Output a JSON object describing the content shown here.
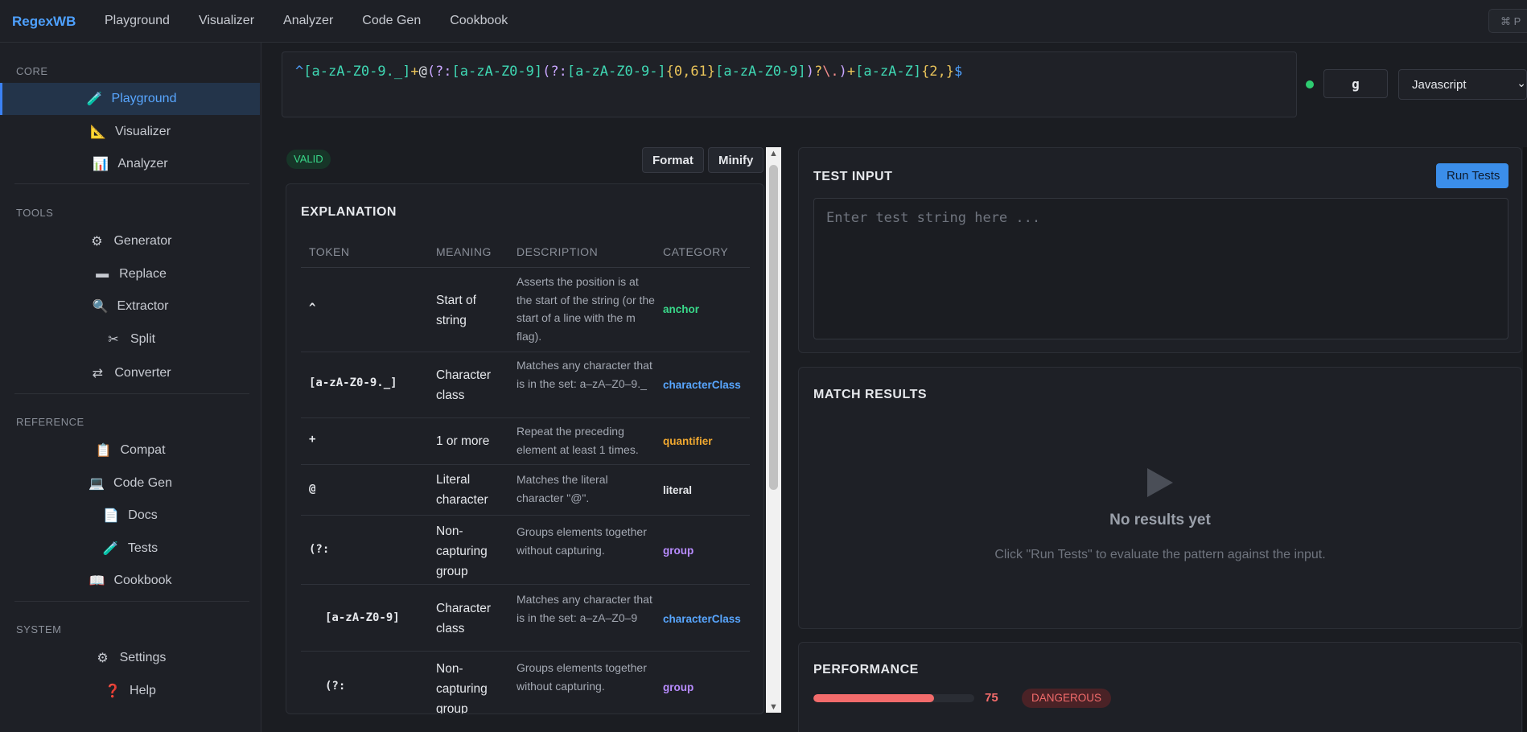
{
  "brand": "RegexWB",
  "nav": [
    "Playground",
    "Visualizer",
    "Analyzer",
    "Code Gen",
    "Cookbook"
  ],
  "shortcut": "⌘ P",
  "sidebar": {
    "sections": [
      {
        "label": "CORE",
        "items": [
          {
            "icon": "🧪",
            "label": "Playground"
          },
          {
            "icon": "📐",
            "label": "Visualizer"
          },
          {
            "icon": "📊",
            "label": "Analyzer"
          }
        ]
      },
      {
        "label": "TOOLS",
        "items": [
          {
            "icon": "⚙",
            "label": "Generator"
          },
          {
            "icon": "▬",
            "label": "Replace"
          },
          {
            "icon": "🔍",
            "label": "Extractor"
          },
          {
            "icon": "✂",
            "label": "Split"
          },
          {
            "icon": "⇄",
            "label": "Converter"
          }
        ]
      },
      {
        "label": "REFERENCE",
        "items": [
          {
            "icon": "📋",
            "label": "Compat"
          },
          {
            "icon": "💻",
            "label": "Code Gen"
          },
          {
            "icon": "📄",
            "label": "Docs"
          },
          {
            "icon": "🧪",
            "label": "Tests"
          },
          {
            "icon": "📖",
            "label": "Cookbook"
          }
        ]
      },
      {
        "label": "SYSTEM",
        "items": [
          {
            "icon": "⚙",
            "label": "Settings"
          },
          {
            "icon": "❓",
            "label": "Help"
          }
        ]
      }
    ]
  },
  "regex": {
    "pattern": "^[a-zA-Z0-9._]+@(?:[a-zA-Z0-9](?:[a-zA-Z0-9-]{0,61}[a-zA-Z0-9])?\\.)+[a-zA-Z]{2,}$",
    "tokens": [
      {
        "t": "^",
        "k": "anchor"
      },
      {
        "t": "[a-zA-Z0-9._]",
        "k": "class"
      },
      {
        "t": "+",
        "k": "quant"
      },
      {
        "t": "@",
        "k": "lit"
      },
      {
        "t": "(?:",
        "k": "group"
      },
      {
        "t": "[a-zA-Z0-9]",
        "k": "class"
      },
      {
        "t": "(?:",
        "k": "group"
      },
      {
        "t": "[a-zA-Z0-9-]",
        "k": "class"
      },
      {
        "t": "{0,61}",
        "k": "quant"
      },
      {
        "t": "[a-zA-Z0-9]",
        "k": "class"
      },
      {
        "t": ")",
        "k": "group"
      },
      {
        "t": "?",
        "k": "quant"
      },
      {
        "t": "\\.",
        "k": "esc"
      },
      {
        "t": ")",
        "k": "group"
      },
      {
        "t": "+",
        "k": "quant"
      },
      {
        "t": "[a-zA-Z]",
        "k": "class"
      },
      {
        "t": "{2,}",
        "k": "quant"
      },
      {
        "t": "$",
        "k": "anchor"
      }
    ],
    "flags": "g",
    "language": "Javascript"
  },
  "status_badge": "VALID",
  "buttons": {
    "format": "Format",
    "minify": "Minify",
    "run_tests": "Run Tests"
  },
  "explanation": {
    "title": "EXPLANATION",
    "columns": [
      "TOKEN",
      "MEANING",
      "DESCRIPTION",
      "CATEGORY"
    ],
    "rows": [
      {
        "token": "^",
        "meaning": "Start of string",
        "description": "Asserts the position is at the start of the string (or the start of a line with the m flag).",
        "category": "anchor",
        "cls": "c-anchor"
      },
      {
        "token": "[a-zA-Z0-9._]",
        "meaning": "Character class",
        "description": "Matches any character that is in the set: a–zA–Z0–9._",
        "category": "characterClass",
        "cls": "c-class"
      },
      {
        "token": "+",
        "meaning": "1 or more",
        "description": "Repeat the preceding element at least 1 times.",
        "category": "quantifier",
        "cls": "c-quant"
      },
      {
        "token": "@",
        "meaning": "Literal character",
        "description": "Matches the literal character \"@\".",
        "category": "literal",
        "cls": "c-lit"
      },
      {
        "token": "(?:",
        "meaning": "Non-capturing group",
        "description": "Groups elements together without capturing.",
        "category": "group",
        "cls": "c-group"
      },
      {
        "token": "[a-zA-Z0-9]",
        "meaning": "Character class",
        "description": "Matches any character that is in the set: a–zA–Z0–9",
        "category": "characterClass",
        "cls": "c-class"
      },
      {
        "token": "(?:",
        "meaning": "Non-capturing group",
        "description": "Groups elements together without capturing.",
        "category": "group",
        "cls": "c-group"
      }
    ]
  },
  "test_input": {
    "title": "TEST INPUT",
    "placeholder": "Enter test string here ..."
  },
  "match_results": {
    "title": "MATCH RESULTS",
    "empty_title": "No results yet",
    "empty_sub": "Click \"Run Tests\" to evaluate the pattern against the input."
  },
  "performance": {
    "title": "PERFORMANCE",
    "score": 75,
    "score_label": "75",
    "rating": "DANGEROUS"
  },
  "colors": {
    "accent": "#3b8eea",
    "valid": "#39d98a",
    "danger": "#f26b6b"
  }
}
